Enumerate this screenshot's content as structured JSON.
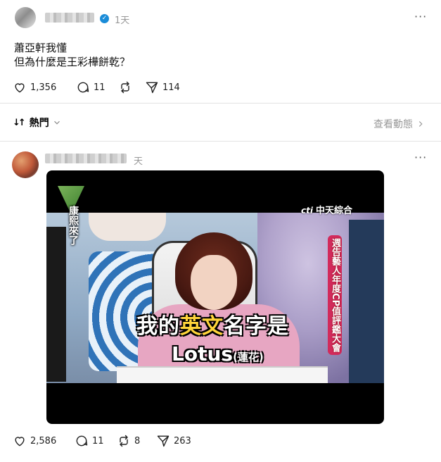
{
  "post": {
    "time_ago": "1天",
    "verified_mark": "✓",
    "more_glyph": "···",
    "text_lines": [
      "蕭亞軒我懂",
      "但為什麼是王彩樺餅乾？"
    ],
    "likes": "1,356",
    "comments": "11",
    "reposts": "",
    "shares": "114"
  },
  "sort": {
    "label": "熱門",
    "arrow_glyph": "↓↑",
    "view_activity": "查看動態"
  },
  "reply": {
    "time_ago": "天",
    "more_glyph": "···",
    "likes": "2,586",
    "comments": "11",
    "reposts": "8",
    "shares": "263"
  },
  "media": {
    "show_title": "康熙來了",
    "channel_brand": "cti",
    "channel_name": "中天綜合",
    "banner": "週告藝人年度CP值評鑑大會",
    "subtitle_line1_a": "我的",
    "subtitle_line1_b": "英文",
    "subtitle_line1_c": "名字是",
    "subtitle_line2": "Lotus",
    "subtitle_line2_paren": "(蓮花)"
  },
  "icons": {
    "heart": "heart-icon",
    "comment": "comment-icon",
    "repost": "repost-icon",
    "share": "share-icon",
    "chevron": "chevron-down-icon",
    "chevron_right": "chevron-right-icon"
  },
  "colors": {
    "verified": "#1a8cd8",
    "muted": "#999999",
    "divider": "#e3e3e3"
  }
}
